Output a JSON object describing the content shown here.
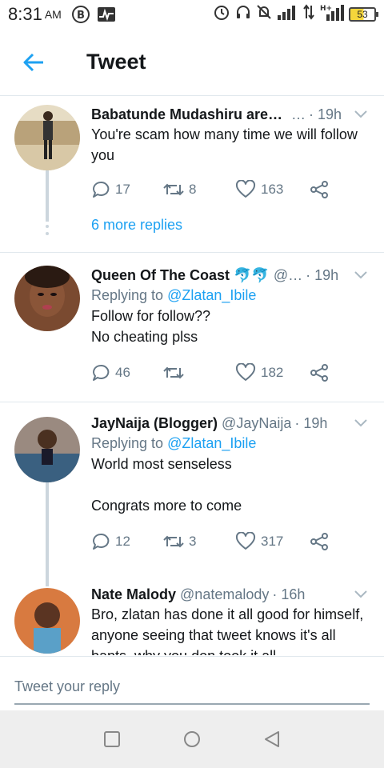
{
  "status_bar": {
    "time": "8:31",
    "ampm": "AM",
    "battery": "53"
  },
  "header": {
    "title": "Tweet"
  },
  "tweets": [
    {
      "name": "Babatunde Mudashiru aremu",
      "handle": "…",
      "time": "· 19h",
      "reply_label": "",
      "mention": "",
      "text": "You're scam how many time we will follow you",
      "replies": "17",
      "retweets": "8",
      "likes": "163",
      "avatar_bg": "#d9c9a8"
    },
    {
      "name": "Queen Of The Coast 🐬🐬",
      "handle": "@…",
      "time": "· 19h",
      "reply_label": "Replying to ",
      "mention": "@Zlatan_Ibile",
      "text": "Follow for follow??\nNo cheating plss",
      "replies": "46",
      "retweets": "",
      "likes": "182",
      "avatar_bg": "#5a3a28"
    },
    {
      "name": "JayNaija (Blogger)",
      "handle": "@JayNaija",
      "time": "· 19h",
      "reply_label": "Replying to ",
      "mention": "@Zlatan_Ibile",
      "text": "World most senseless\n\nCongrats more to come",
      "replies": "12",
      "retweets": "3",
      "likes": "317",
      "avatar_bg": "#3d5a7a"
    },
    {
      "name": "Nate Malody",
      "handle": "@natemalody",
      "time": "· 16h",
      "reply_label": "",
      "mention": "",
      "text": "Bro, zlatan has done it all good for himself, anyone seeing that tweet knows it's all bants, why you don took it all",
      "avatar_bg": "#c8663a"
    }
  ],
  "more_replies": "6 more replies",
  "reply_bar": {
    "placeholder": "Tweet your reply"
  },
  "colors": {
    "accent": "#1da1f2",
    "muted": "#657786",
    "text": "#14171a"
  }
}
